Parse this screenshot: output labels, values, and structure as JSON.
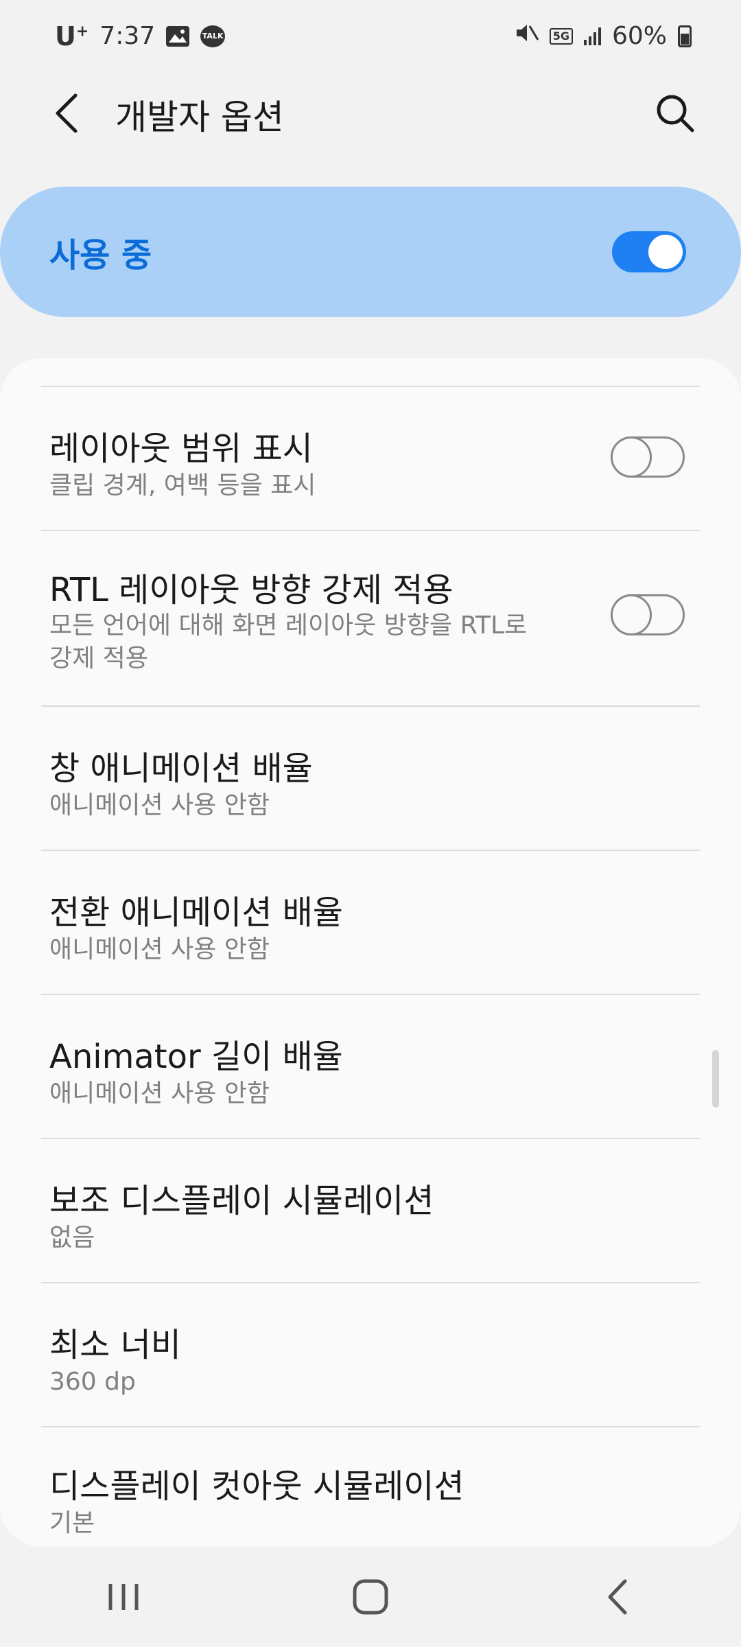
{
  "status_bar": {
    "carrier": "U",
    "carrier_sup": "+",
    "time": "7:37",
    "talk_badge": "TALK",
    "network": "5G",
    "battery": "60%"
  },
  "header": {
    "title": "개발자 옵션",
    "back_icon": "back-arrow-icon",
    "search_icon": "search-icon"
  },
  "master": {
    "label": "사용 중",
    "enabled": true
  },
  "settings": [
    {
      "title": "레이아웃 범위 표시",
      "subtitle": "클립 경계, 여백 등을 표시",
      "toggle": false
    },
    {
      "title": "RTL 레이아웃 방향 강제 적용",
      "subtitle_line1": "모든 언어에 대해 화면 레이아웃 방향을 RTL로",
      "subtitle_line2": "강제 적용",
      "toggle": false
    },
    {
      "title": "창 애니메이션 배율",
      "subtitle": "애니메이션 사용 안함"
    },
    {
      "title": "전환 애니메이션 배율",
      "subtitle": "애니메이션 사용 안함"
    },
    {
      "title": "Animator 길이 배율",
      "subtitle": "애니메이션 사용 안함"
    },
    {
      "title": "보조 디스플레이 시뮬레이션",
      "subtitle": "없음"
    },
    {
      "title": "최소 너비",
      "subtitle": "360 dp"
    },
    {
      "title": "디스플레이 컷아웃 시뮬레이션",
      "subtitle": "기본"
    }
  ],
  "colors": {
    "accent": "#1e80f2",
    "master_bg": "#abd0f8",
    "master_text": "#0b6cd8"
  }
}
